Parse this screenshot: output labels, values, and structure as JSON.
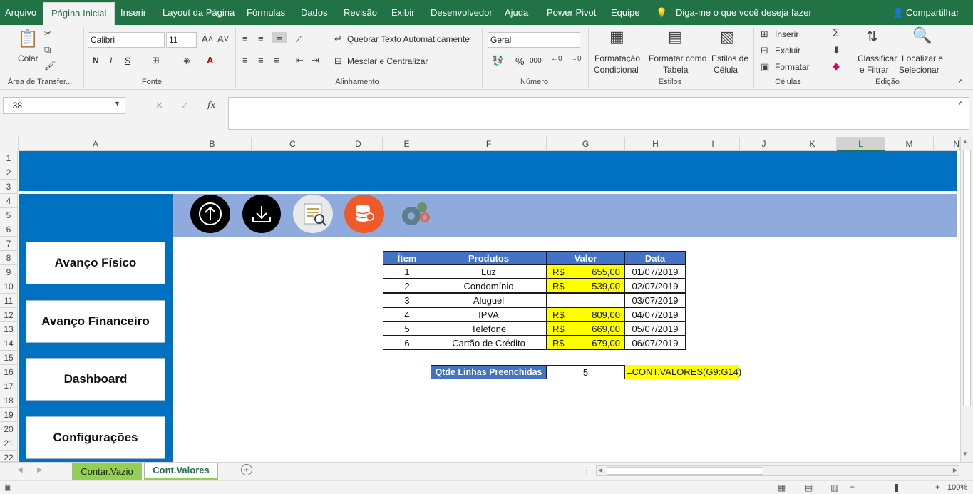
{
  "tabs": [
    "Arquivo",
    "Página Inicial",
    "Inserir",
    "Layout da Página",
    "Fórmulas",
    "Dados",
    "Revisão",
    "Exibir",
    "Desenvolvedor",
    "Ajuda",
    "Power Pivot",
    "Equipe"
  ],
  "tell_me": "Diga-me o que você deseja fazer",
  "share": "Compartilhar",
  "clipboard": {
    "paste": "Colar",
    "label": "Área de Transfer..."
  },
  "font": {
    "name": "Calibri",
    "size": "11",
    "label": "Fonte",
    "bold": "N",
    "italic": "I",
    "underline": "S"
  },
  "alignment": {
    "wrap": "Quebrar Texto Automaticamente",
    "merge": "Mesclar e Centralizar",
    "label": "Alinhamento"
  },
  "number": {
    "format": "Geral",
    "label": "Número",
    "percent": "%",
    "thousands": "000"
  },
  "styles": {
    "cond1": "Formatação",
    "cond2": "Condicional",
    "table1": "Formatar como",
    "table2": "Tabela",
    "cell1": "Estilos de",
    "cell2": "Célula",
    "label": "Estilos"
  },
  "cells": {
    "insert": "Inserir",
    "delete": "Excluir",
    "format": "Formatar",
    "label": "Células"
  },
  "editing": {
    "sort1": "Classificar",
    "sort2": "e Filtrar",
    "find1": "Localizar e",
    "find2": "Selecionar",
    "label": "Edição"
  },
  "namebox": "L38",
  "fx": "fx",
  "columns": [
    "A",
    "B",
    "C",
    "D",
    "E",
    "F",
    "G",
    "H",
    "I",
    "J",
    "K",
    "L",
    "M",
    "N"
  ],
  "rows": [
    "1",
    "2",
    "3",
    "4",
    "5",
    "6",
    "7",
    "8",
    "9",
    "10",
    "11",
    "12",
    "13",
    "14",
    "15",
    "16",
    "17",
    "18",
    "19",
    "20",
    "21",
    "22"
  ],
  "menu": [
    "Avanço Físico",
    "Avanço Financeiro",
    "Dashboard",
    "Configurações"
  ],
  "table": {
    "headers": [
      "Ítem",
      "Produtos",
      "Valor",
      "Data"
    ],
    "currency": "R$",
    "rows": [
      {
        "item": "1",
        "produto": "Luz",
        "valor": "655,00",
        "data": "01/07/2019"
      },
      {
        "item": "2",
        "produto": "Condomínio",
        "valor": "539,00",
        "data": "02/07/2019"
      },
      {
        "item": "3",
        "produto": "Aluguel",
        "valor": "",
        "data": "03/07/2019"
      },
      {
        "item": "4",
        "produto": "IPVA",
        "valor": "809,00",
        "data": "04/07/2019"
      },
      {
        "item": "5",
        "produto": "Telefone",
        "valor": "669,00",
        "data": "05/07/2019"
      },
      {
        "item": "6",
        "produto": "Cartão de Crédito",
        "valor": "679,00",
        "data": "06/07/2019"
      }
    ]
  },
  "summary": {
    "label": "Qtde Linhas Preenchidas",
    "value": "5",
    "formula": "=CONT.VALORES(G9:G14)"
  },
  "sheets": [
    "Contar.Vazio",
    "Cont.Valores"
  ],
  "zoom": "100%",
  "colors": {
    "excel_green": "#217346",
    "nav_blue": "#0070c0",
    "banner_light": "#8faadc",
    "table_header": "#4472c4",
    "highlight": "#ffff00"
  }
}
